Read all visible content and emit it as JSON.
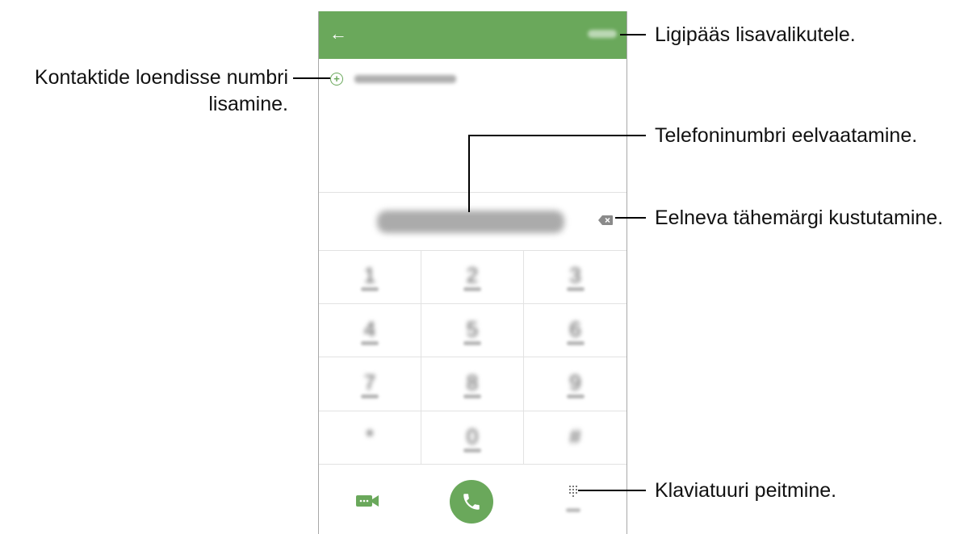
{
  "topbar": {
    "back_glyph": "←",
    "color": "#6aa85b"
  },
  "add_row": {
    "plus_glyph": "+"
  },
  "callouts": {
    "add_contact_line1": "Kontaktide loendisse numbri",
    "add_contact_line2": "lisamine.",
    "more_options": "Ligipääs lisavalikutele.",
    "preview": "Telefoninumbri eelvaatamine.",
    "delete_char": "Eelneva tähemärgi kustutamine.",
    "hide_keypad": "Klaviatuuri peitmine."
  },
  "keypad": {
    "keys": [
      {
        "digit": "1"
      },
      {
        "digit": "2"
      },
      {
        "digit": "3"
      },
      {
        "digit": "4"
      },
      {
        "digit": "5"
      },
      {
        "digit": "6"
      },
      {
        "digit": "7"
      },
      {
        "digit": "8"
      },
      {
        "digit": "9"
      },
      {
        "digit": "*"
      },
      {
        "digit": "0"
      },
      {
        "digit": "#"
      }
    ]
  },
  "icons": {
    "back": "back-arrow-icon",
    "add": "plus-circle-icon",
    "backspace": "backspace-icon",
    "video": "video-call-icon",
    "call": "phone-icon",
    "hide": "keypad-grid-icon"
  }
}
